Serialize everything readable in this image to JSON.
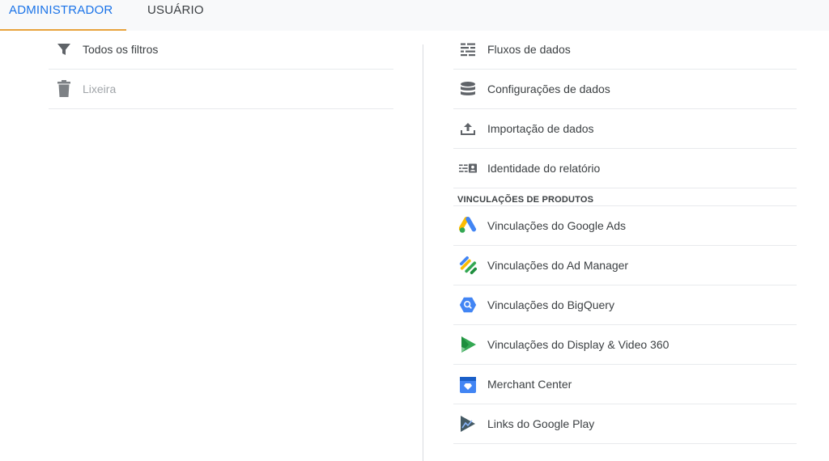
{
  "tabs": [
    {
      "label": "ADMINISTRADOR",
      "active": true
    },
    {
      "label": "USUÁRIO",
      "active": false
    }
  ],
  "left_column": {
    "items": [
      {
        "label": "Todos os filtros",
        "icon": "filter-icon",
        "disabled": false
      },
      {
        "label": "Lixeira",
        "icon": "trash-icon",
        "disabled": true
      }
    ]
  },
  "right_column": {
    "items": [
      {
        "label": "Fluxos de dados",
        "icon": "data-streams-icon"
      },
      {
        "label": "Configurações de dados",
        "icon": "database-icon"
      },
      {
        "label": "Importação de dados",
        "icon": "upload-icon"
      },
      {
        "label": "Identidade do relatório",
        "icon": "reporting-identity-icon"
      }
    ],
    "section_title": "VINCULAÇÕES DE PRODUTOS",
    "product_links": [
      {
        "label": "Vinculações do Google Ads",
        "icon": "google-ads-icon"
      },
      {
        "label": "Vinculações do Ad Manager",
        "icon": "ad-manager-icon"
      },
      {
        "label": "Vinculações do BigQuery",
        "icon": "bigquery-icon"
      },
      {
        "label": "Vinculações do Display & Video 360",
        "icon": "display-video-360-icon"
      },
      {
        "label": "Merchant Center",
        "icon": "merchant-center-icon"
      },
      {
        "label": "Links do Google Play",
        "icon": "google-play-icon"
      }
    ]
  },
  "colors": {
    "accent": "#1a73e8",
    "tab_indicator": "#e8a33d",
    "icon_gray": "#5f6368",
    "disabled": "#a0a4a8"
  }
}
